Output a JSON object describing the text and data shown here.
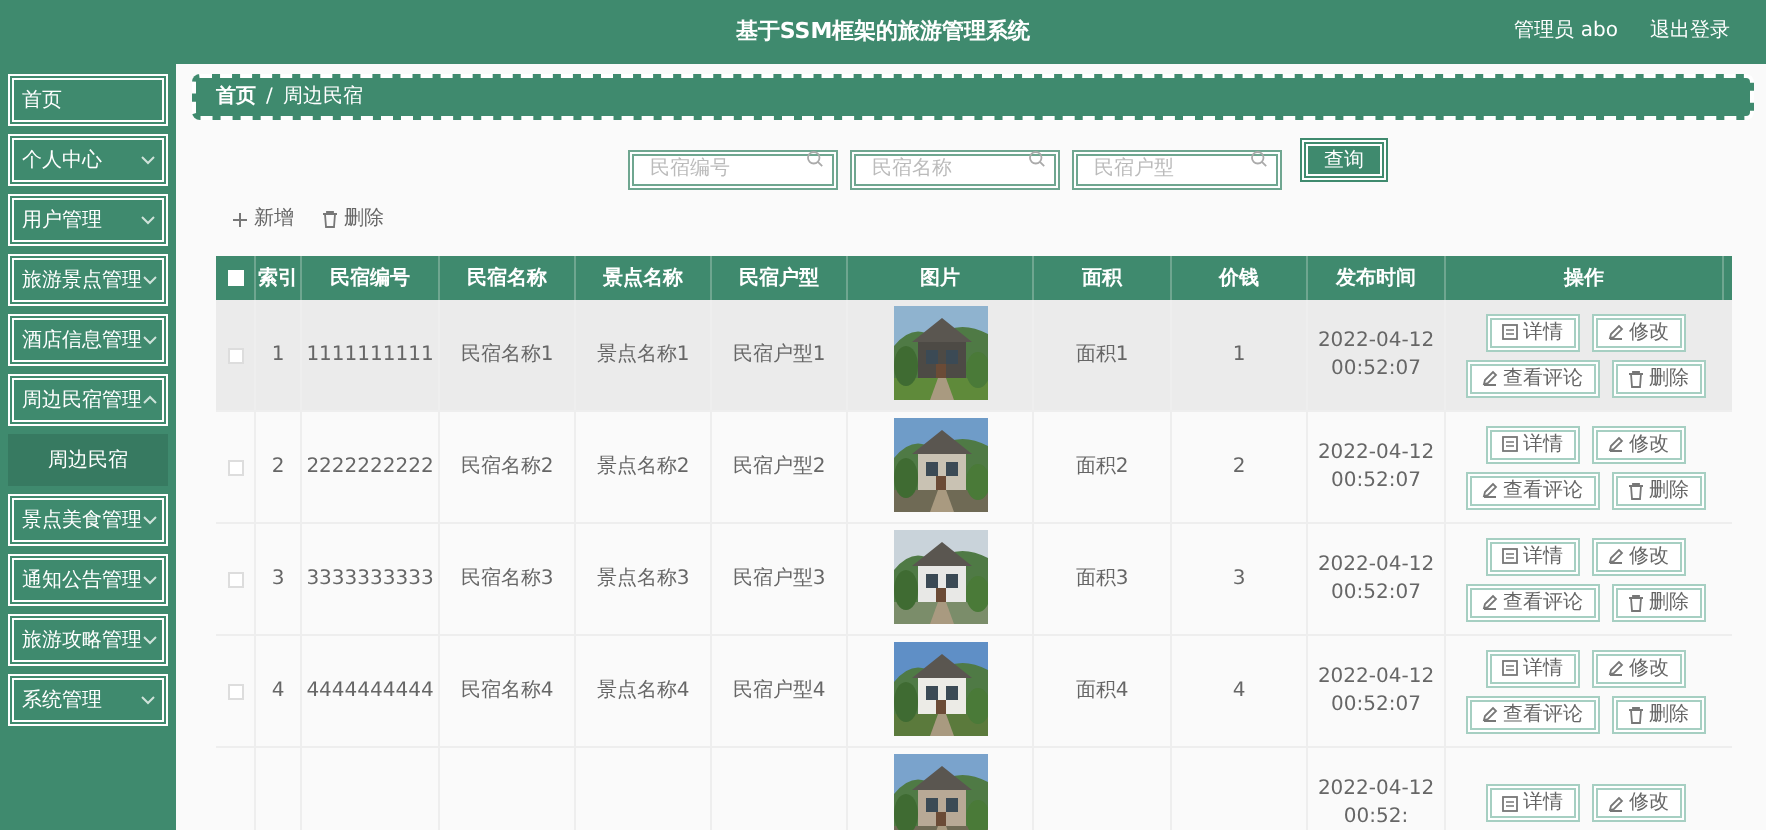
{
  "header": {
    "title": "基于SSM框架的旅游管理系统",
    "user": "管理员 abo",
    "logout": "退出登录"
  },
  "sidebar": {
    "items": [
      {
        "label": "首页",
        "kind": "link"
      },
      {
        "label": "个人中心",
        "kind": "submenu",
        "expanded": false
      },
      {
        "label": "用户管理",
        "kind": "submenu",
        "expanded": false
      },
      {
        "label": "旅游景点管理",
        "kind": "submenu",
        "expanded": false
      },
      {
        "label": "酒店信息管理",
        "kind": "submenu",
        "expanded": false
      },
      {
        "label": "周边民宿管理",
        "kind": "submenu",
        "expanded": true,
        "children": [
          {
            "label": "周边民宿",
            "selected": true
          }
        ]
      },
      {
        "label": "景点美食管理",
        "kind": "submenu",
        "expanded": false
      },
      {
        "label": "通知公告管理",
        "kind": "submenu",
        "expanded": false
      },
      {
        "label": "旅游攻略管理",
        "kind": "submenu",
        "expanded": false
      },
      {
        "label": "系统管理",
        "kind": "submenu",
        "expanded": false
      }
    ]
  },
  "breadcrumb": {
    "items": [
      "首页",
      "周边民宿"
    ],
    "separator": "/"
  },
  "search": {
    "fields": [
      {
        "placeholder": "民宿编号"
      },
      {
        "placeholder": "民宿名称"
      },
      {
        "placeholder": "民宿户型"
      }
    ],
    "button": "查询"
  },
  "actions": [
    {
      "label": "新增",
      "kind": "add"
    },
    {
      "label": "删除",
      "kind": "delete"
    }
  ],
  "table": {
    "select_all": {
      "checked": false
    },
    "columns": [
      "索引",
      "民宿编号",
      "民宿名称",
      "景点名称",
      "民宿户型",
      "图片",
      "面积",
      "价钱",
      "发布时间",
      "操作"
    ],
    "rows": [
      {
        "checked": false,
        "hovered": true,
        "cells": [
          "1",
          "1111111111",
          "民宿名称1",
          "景点名称1",
          "民宿户型1"
        ],
        "area": "面积1",
        "price": "1",
        "time": "2022-04-12 00:52:07",
        "buttons": [
          "详情",
          "修改",
          "查看评论",
          "删除"
        ]
      },
      {
        "checked": false,
        "hovered": false,
        "cells": [
          "2",
          "2222222222",
          "民宿名称2",
          "景点名称2",
          "民宿户型2"
        ],
        "area": "面积2",
        "price": "2",
        "time": "2022-04-12 00:52:07",
        "buttons": [
          "详情",
          "修改",
          "查看评论",
          "删除"
        ]
      },
      {
        "checked": false,
        "hovered": false,
        "cells": [
          "3",
          "3333333333",
          "民宿名称3",
          "景点名称3",
          "民宿户型3"
        ],
        "area": "面积3",
        "price": "3",
        "time": "2022-04-12 00:52:07",
        "buttons": [
          "详情",
          "修改",
          "查看评论",
          "删除"
        ]
      },
      {
        "checked": false,
        "hovered": false,
        "cells": [
          "4",
          "4444444444",
          "民宿名称4",
          "景点名称4",
          "民宿户型4"
        ],
        "area": "面积4",
        "price": "4",
        "time": "2022-04-12 00:52:07",
        "buttons": [
          "详情",
          "修改",
          "查看评论",
          "删除"
        ]
      },
      {
        "time": "2022-04-12 00:52:",
        "buttons": [
          "详情",
          "修改"
        ]
      }
    ]
  }
}
